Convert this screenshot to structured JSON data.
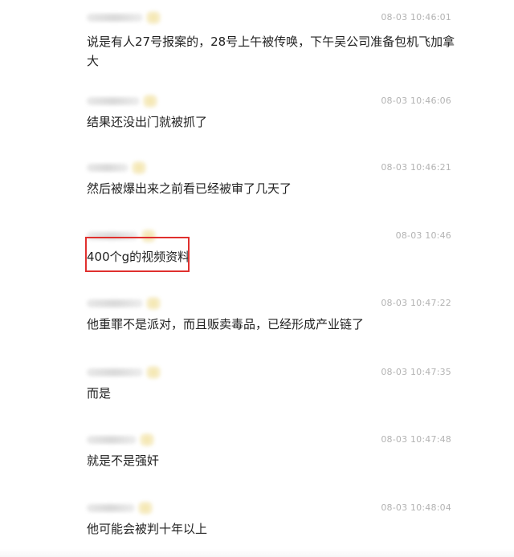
{
  "comments": [
    {
      "time": "08-03 10:46:01",
      "text": "说是有人27号报案的，28号上午被传唤，下午吴公司准备包机飞加拿大"
    },
    {
      "time": "08-03 10:46:06",
      "text": "结果还没出门就被抓了"
    },
    {
      "time": "08-03 10:46:21",
      "text": "然后被爆出来之前看已经被审了几天了"
    },
    {
      "time": "08-03 10:46",
      "text": "400个g的视频资料"
    },
    {
      "time": "08-03 10:47:22",
      "text": "他重罪不是派对，而且贩卖毒品，已经形成产业链了"
    },
    {
      "time": "08-03 10:47:35",
      "text": "而是"
    },
    {
      "time": "08-03 10:47:48",
      "text": "就是不是强奸"
    },
    {
      "time": "08-03 10:48:04",
      "text": "他可能会被判十年以上"
    }
  ],
  "colors": {
    "highlight_border": "#e0302e",
    "timestamp": "#b3b3b3",
    "text": "#222222"
  }
}
